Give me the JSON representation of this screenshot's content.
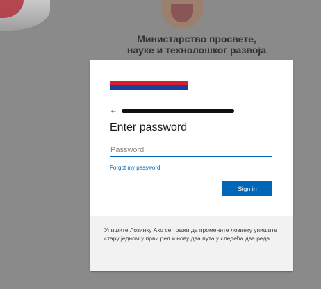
{
  "page": {
    "ministry_line1": "Министарство просвете,",
    "ministry_line2": "науке и технолошког развоја"
  },
  "login": {
    "flag_colors": [
      "#d41f2e",
      "#1b3f9c",
      "#ffffff"
    ],
    "back_arrow": "←",
    "account_redacted": true,
    "heading": "Enter password",
    "password_placeholder": "Password",
    "password_value": "",
    "forgot_link": "Forgot my password",
    "signin_label": "Sign in",
    "accent_color": "#0067b8"
  },
  "footer": {
    "note": "Упишите Лозинку Ако се тражи да промените лозинку упишите стару једном у први ред и нову два пута у следећа два реда"
  }
}
